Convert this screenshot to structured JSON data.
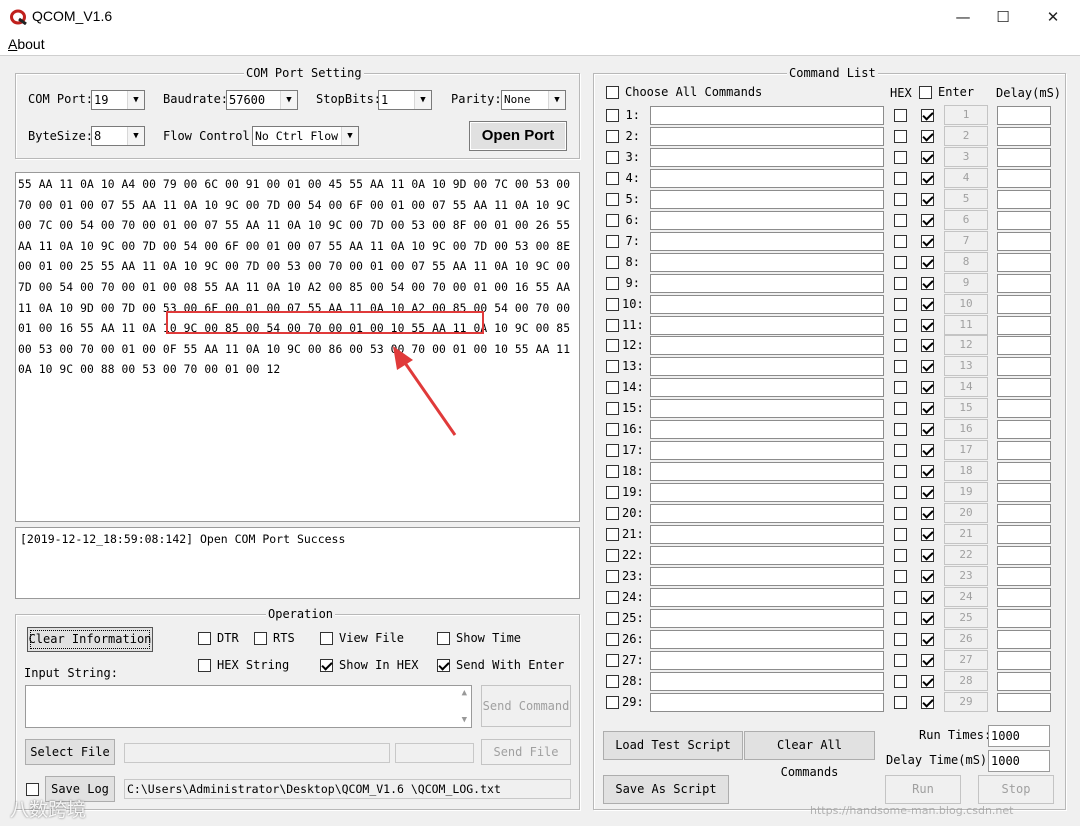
{
  "window": {
    "title": "QCOM_V1.6",
    "minimize": "—",
    "maximize": "☐",
    "close": "✕"
  },
  "menu": {
    "about_first": "A",
    "about_rest": "bout"
  },
  "com_settings": {
    "title": "COM Port Setting",
    "com_port_label": "COM Port:",
    "com_port": "19",
    "baudrate_label": "Baudrate:",
    "baudrate": "57600",
    "stopbits_label": "StopBits:",
    "stopbits": "1",
    "parity_label": "Parity:",
    "parity": "None",
    "bytesize_label": "ByteSize:",
    "bytesize": "8",
    "flow_label": "Flow Control:",
    "flow": "No Ctrl Flow",
    "open_port": "Open Port"
  },
  "receive_text": "55 AA 11 0A 10 A4 00 79 00 6C 00 91 00 01 00 45 55 AA 11 0A 10 9D 00 7C 00 53 00 70 00 01 00 07 55 AA 11 0A 10 9C 00 7D 00 54 00 6F 00 01 00 07 55 AA 11 0A 10 9C 00 7C 00 54 00 70 00 01 00 07 55 AA 11 0A 10 9C 00 7D 00 53 00 8F 00 01 00 26 55 AA 11 0A 10 9C 00 7D 00 54 00 6F 00 01 00 07 55 AA 11 0A 10 9C 00 7D 00 53 00 8E 00 01 00 25 55 AA 11 0A 10 9C 00 7D 00 53 00 70 00 01 00 07 55 AA 11 0A 10 9C 00 7D 00 54 00 70 00 01 00 08 55 AA 11 0A 10 A2 00 85 00 54 00 70 00 01 00 16 55 AA 11 0A 10 9D 00 7D 00 53 00 6F 00 01 00 07 55 AA 11 0A 10 A2 00 85 00 54 00 70 00 01 00 16 55 AA 11 0A 10 9C 00 85 00 54 00 70 00 01 00 10 55 AA 11 0A 10 9C 00 85 00 53 00 70 00 01 00 0F 55 AA 11 0A 10 9C 00 86 00 53 00 70 00 01 00 10 55 AA 11 0A 10 9C 00 88 00 53 00 70 00 01 00 12",
  "log_text": "[2019-12-12_18:59:08:142] Open COM Port Success",
  "operation": {
    "title": "Operation",
    "clear_info": "Clear Information",
    "dtr": "DTR",
    "rts": "RTS",
    "view_file": "View File",
    "show_time": "Show Time",
    "hex_string": "HEX String",
    "show_in_hex": "Show In HEX",
    "send_with_enter": "Send With Enter",
    "input_label": "Input String:",
    "send_command": "Send Command",
    "select_file": "Select File",
    "send_file": "Send File",
    "save_log": "Save Log",
    "log_path": "C:\\Users\\Administrator\\Desktop\\QCOM_V1.6 \\QCOM_LOG.txt"
  },
  "command_list": {
    "title": "Command List",
    "choose_all": "Choose All Commands",
    "hex": "HEX",
    "enter": "Enter",
    "delay": "Delay(mS)",
    "rows": [
      "1:",
      "2:",
      "3:",
      "4:",
      "5:",
      "6:",
      "7:",
      "8:",
      "9:",
      "10:",
      "11:",
      "12:",
      "13:",
      "14:",
      "15:",
      "16:",
      "17:",
      "18:",
      "19:",
      "20:",
      "21:",
      "22:",
      "23:",
      "24:",
      "25:",
      "26:",
      "27:",
      "28:",
      "29:"
    ],
    "buttons": [
      "1",
      "2",
      "3",
      "4",
      "5",
      "6",
      "7",
      "8",
      "9",
      "10",
      "11",
      "12",
      "13",
      "14",
      "15",
      "16",
      "17",
      "18",
      "19",
      "20",
      "21",
      "22",
      "23",
      "24",
      "25",
      "26",
      "27",
      "28",
      "29"
    ],
    "load_script": "Load Test Script",
    "clear_all": "Clear All Commands",
    "save_script": "Save As Script",
    "run_times_label": "Run Times:",
    "run_times": "1000",
    "delay_time_label": "Delay Time(mS):",
    "delay_time": "1000",
    "run": "Run",
    "stop": "Stop"
  },
  "watermark": {
    "brand": "八数跨境",
    "url": "https://handsome-man.blog.csdn.net"
  },
  "colors": {
    "highlight": "#e03a3a",
    "arrow": "#e03a3a"
  }
}
